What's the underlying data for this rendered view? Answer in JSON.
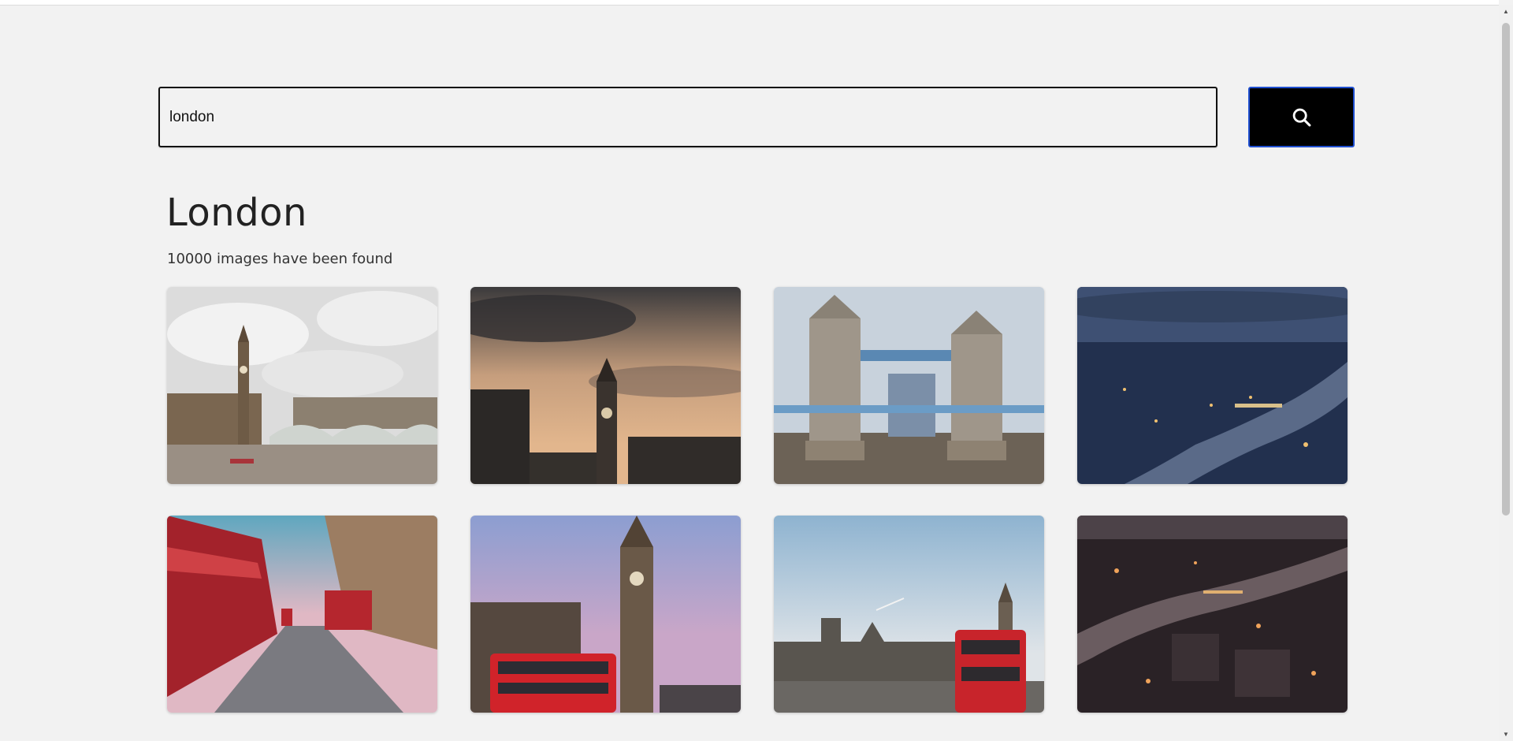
{
  "search": {
    "value": "london",
    "button_icon": "search-icon"
  },
  "results": {
    "title": "London",
    "count_text": "10000 images have been found"
  },
  "images": [
    {
      "subject": "westminster-bridge-big-ben-icon",
      "colors": {
        "sky": "#d9dadb",
        "ground": "#8f8272",
        "accent": "#6b5a45"
      }
    },
    {
      "subject": "big-ben-sunset-icon",
      "colors": {
        "sky": "#caa88a",
        "ground": "#2c2a28",
        "accent": "#3a3633"
      }
    },
    {
      "subject": "tower-bridge-icon",
      "colors": {
        "sky": "#c9d3dd",
        "ground": "#6d6254",
        "accent": "#9b9283"
      }
    },
    {
      "subject": "aerial-thames-night-icon",
      "colors": {
        "sky": "#3c4f74",
        "ground": "#1e2a44",
        "accent": "#e9b96a"
      }
    },
    {
      "subject": "red-bus-street-icon",
      "colors": {
        "sky": "#7bb1c3",
        "ground": "#6a6a70",
        "accent": "#b8202a"
      }
    },
    {
      "subject": "big-ben-red-bus-icon",
      "colors": {
        "sky": "#9a9ac9",
        "ground": "#4b4340",
        "accent": "#d0232a"
      }
    },
    {
      "subject": "parliament-red-bus-icon",
      "colors": {
        "sky": "#b6cde0",
        "ground": "#5c5954",
        "accent": "#c8242b"
      }
    },
    {
      "subject": "aerial-city-night-icon",
      "colors": {
        "sky": "#4a4045",
        "ground": "#2b2428",
        "accent": "#e49a52"
      }
    }
  ]
}
